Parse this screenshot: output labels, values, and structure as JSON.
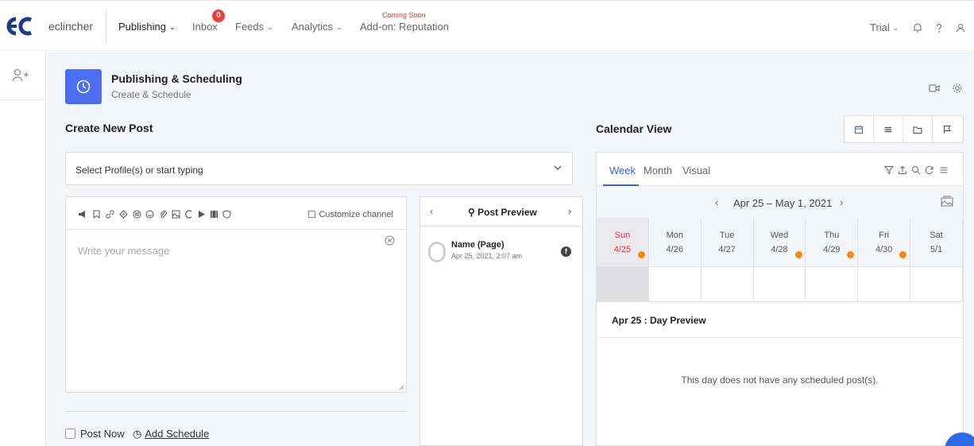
{
  "colors": {
    "accent": "#4a6df2",
    "link": "#3a62e0",
    "alert": "#e53535",
    "event_dot": "#f08a0c"
  },
  "nav": {
    "brand": "eclincher",
    "items": [
      "Publishing",
      "Inbox",
      "Feeds",
      "Analytics",
      "Add-on: Reputation"
    ],
    "inbox_badge": "0",
    "coming_soon": "Coming Soon",
    "trial": "Trial"
  },
  "header": {
    "title": "Publishing & Scheduling",
    "subtitle": "Create & Schedule"
  },
  "create": {
    "title": "Create New Post",
    "profile_select": "Select Profile(s) or start typing",
    "customize": "Customize channel",
    "message_placeholder": "Write your message",
    "post_now": "Post Now",
    "add_schedule": "Add Schedule"
  },
  "preview": {
    "title": "Post Preview",
    "name": "Name (Page)",
    "date": "Apr 25, 2021, 2:07 am",
    "network_icon": "f"
  },
  "calendar": {
    "title": "Calendar View",
    "tabs": [
      "Week",
      "Month",
      "Visual"
    ],
    "range": "Apr 25 – May 1, 2021",
    "days": [
      {
        "name": "Sun",
        "date": "4/25"
      },
      {
        "name": "Mon",
        "date": "4/26"
      },
      {
        "name": "Tue",
        "date": "4/27"
      },
      {
        "name": "Wed",
        "date": "4/28"
      },
      {
        "name": "Thu",
        "date": "4/29"
      },
      {
        "name": "Fri",
        "date": "4/30"
      },
      {
        "name": "Sat",
        "date": "5/1"
      }
    ],
    "days_with_posts": [
      "4/25",
      "4/28",
      "4/29",
      "4/30"
    ],
    "day_preview": "Apr 25 : Day Preview",
    "empty_message": "This day does not have any scheduled post(s)."
  }
}
